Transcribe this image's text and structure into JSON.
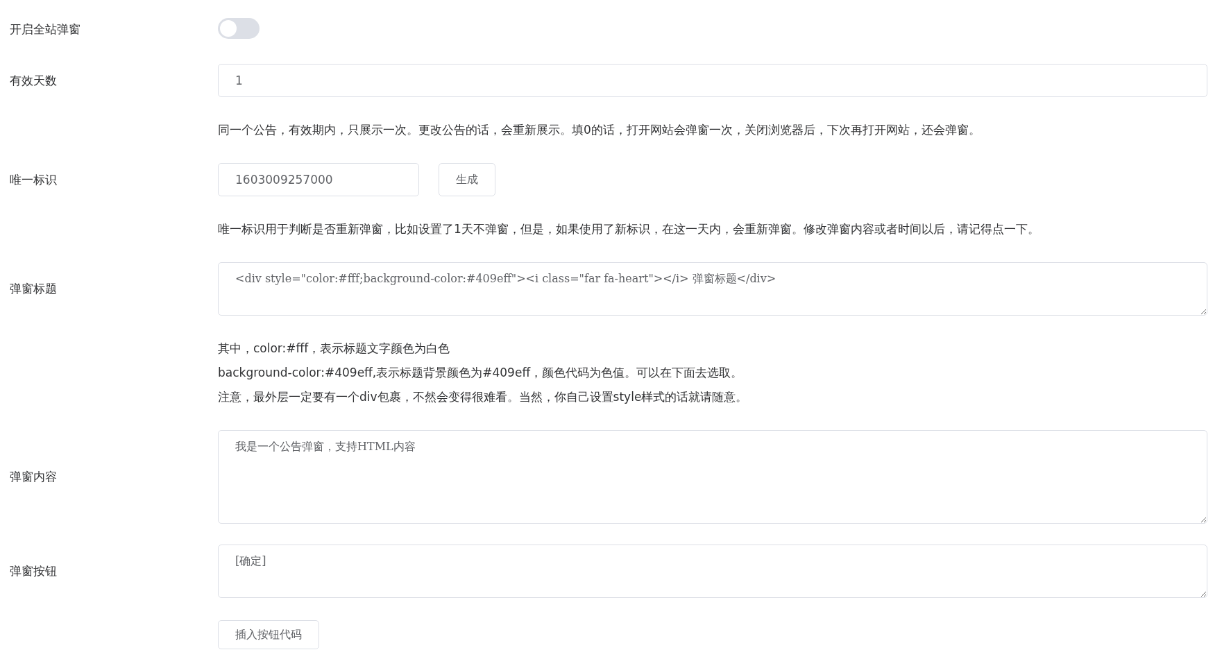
{
  "fields": [
    {
      "kind": "switch",
      "label": "开启全站弹窗",
      "on": false
    },
    {
      "kind": "input",
      "label": "有效天数",
      "value": "1",
      "help": [
        "同一个公告，有效期内，只展示一次。更改公告的话，会重新展示。填0的话，打开网站会弹窗一次，关闭浏览器后，下次再打开网站，还会弹窗。"
      ]
    },
    {
      "kind": "input_button",
      "label": "唯一标识",
      "value": "1603009257000",
      "button": "生成",
      "help": [
        "唯一标识用于判断是否重新弹窗，比如设置了1天不弹窗，但是，如果使用了新标识，在这一天内，会重新弹窗。修改弹窗内容或者时间以后，请记得点一下。"
      ]
    },
    {
      "kind": "textarea",
      "label": "弹窗标题",
      "value": "<div style=\"color:#fff;background-color:#409eff\"><i class=\"far fa-heart\"></i> 弹窗标题</div>",
      "help": [
        "其中，color:#fff，表示标题文字颜色为白色",
        "background-color:#409eff,表示标题背景颜色为#409eff，颜色代码为色值。可以在下面去选取。",
        "注意，最外层一定要有一个div包裹，不然会变得很难看。当然，你自己设置style样式的话就请随意。"
      ]
    },
    {
      "kind": "large_textarea",
      "label": "弹窗内容",
      "value": "我是一个公告弹窗，支持HTML内容"
    },
    {
      "kind": "textarea",
      "label": "弹窗按钮",
      "value": "[确定]",
      "button": "插入按钮代码"
    }
  ]
}
